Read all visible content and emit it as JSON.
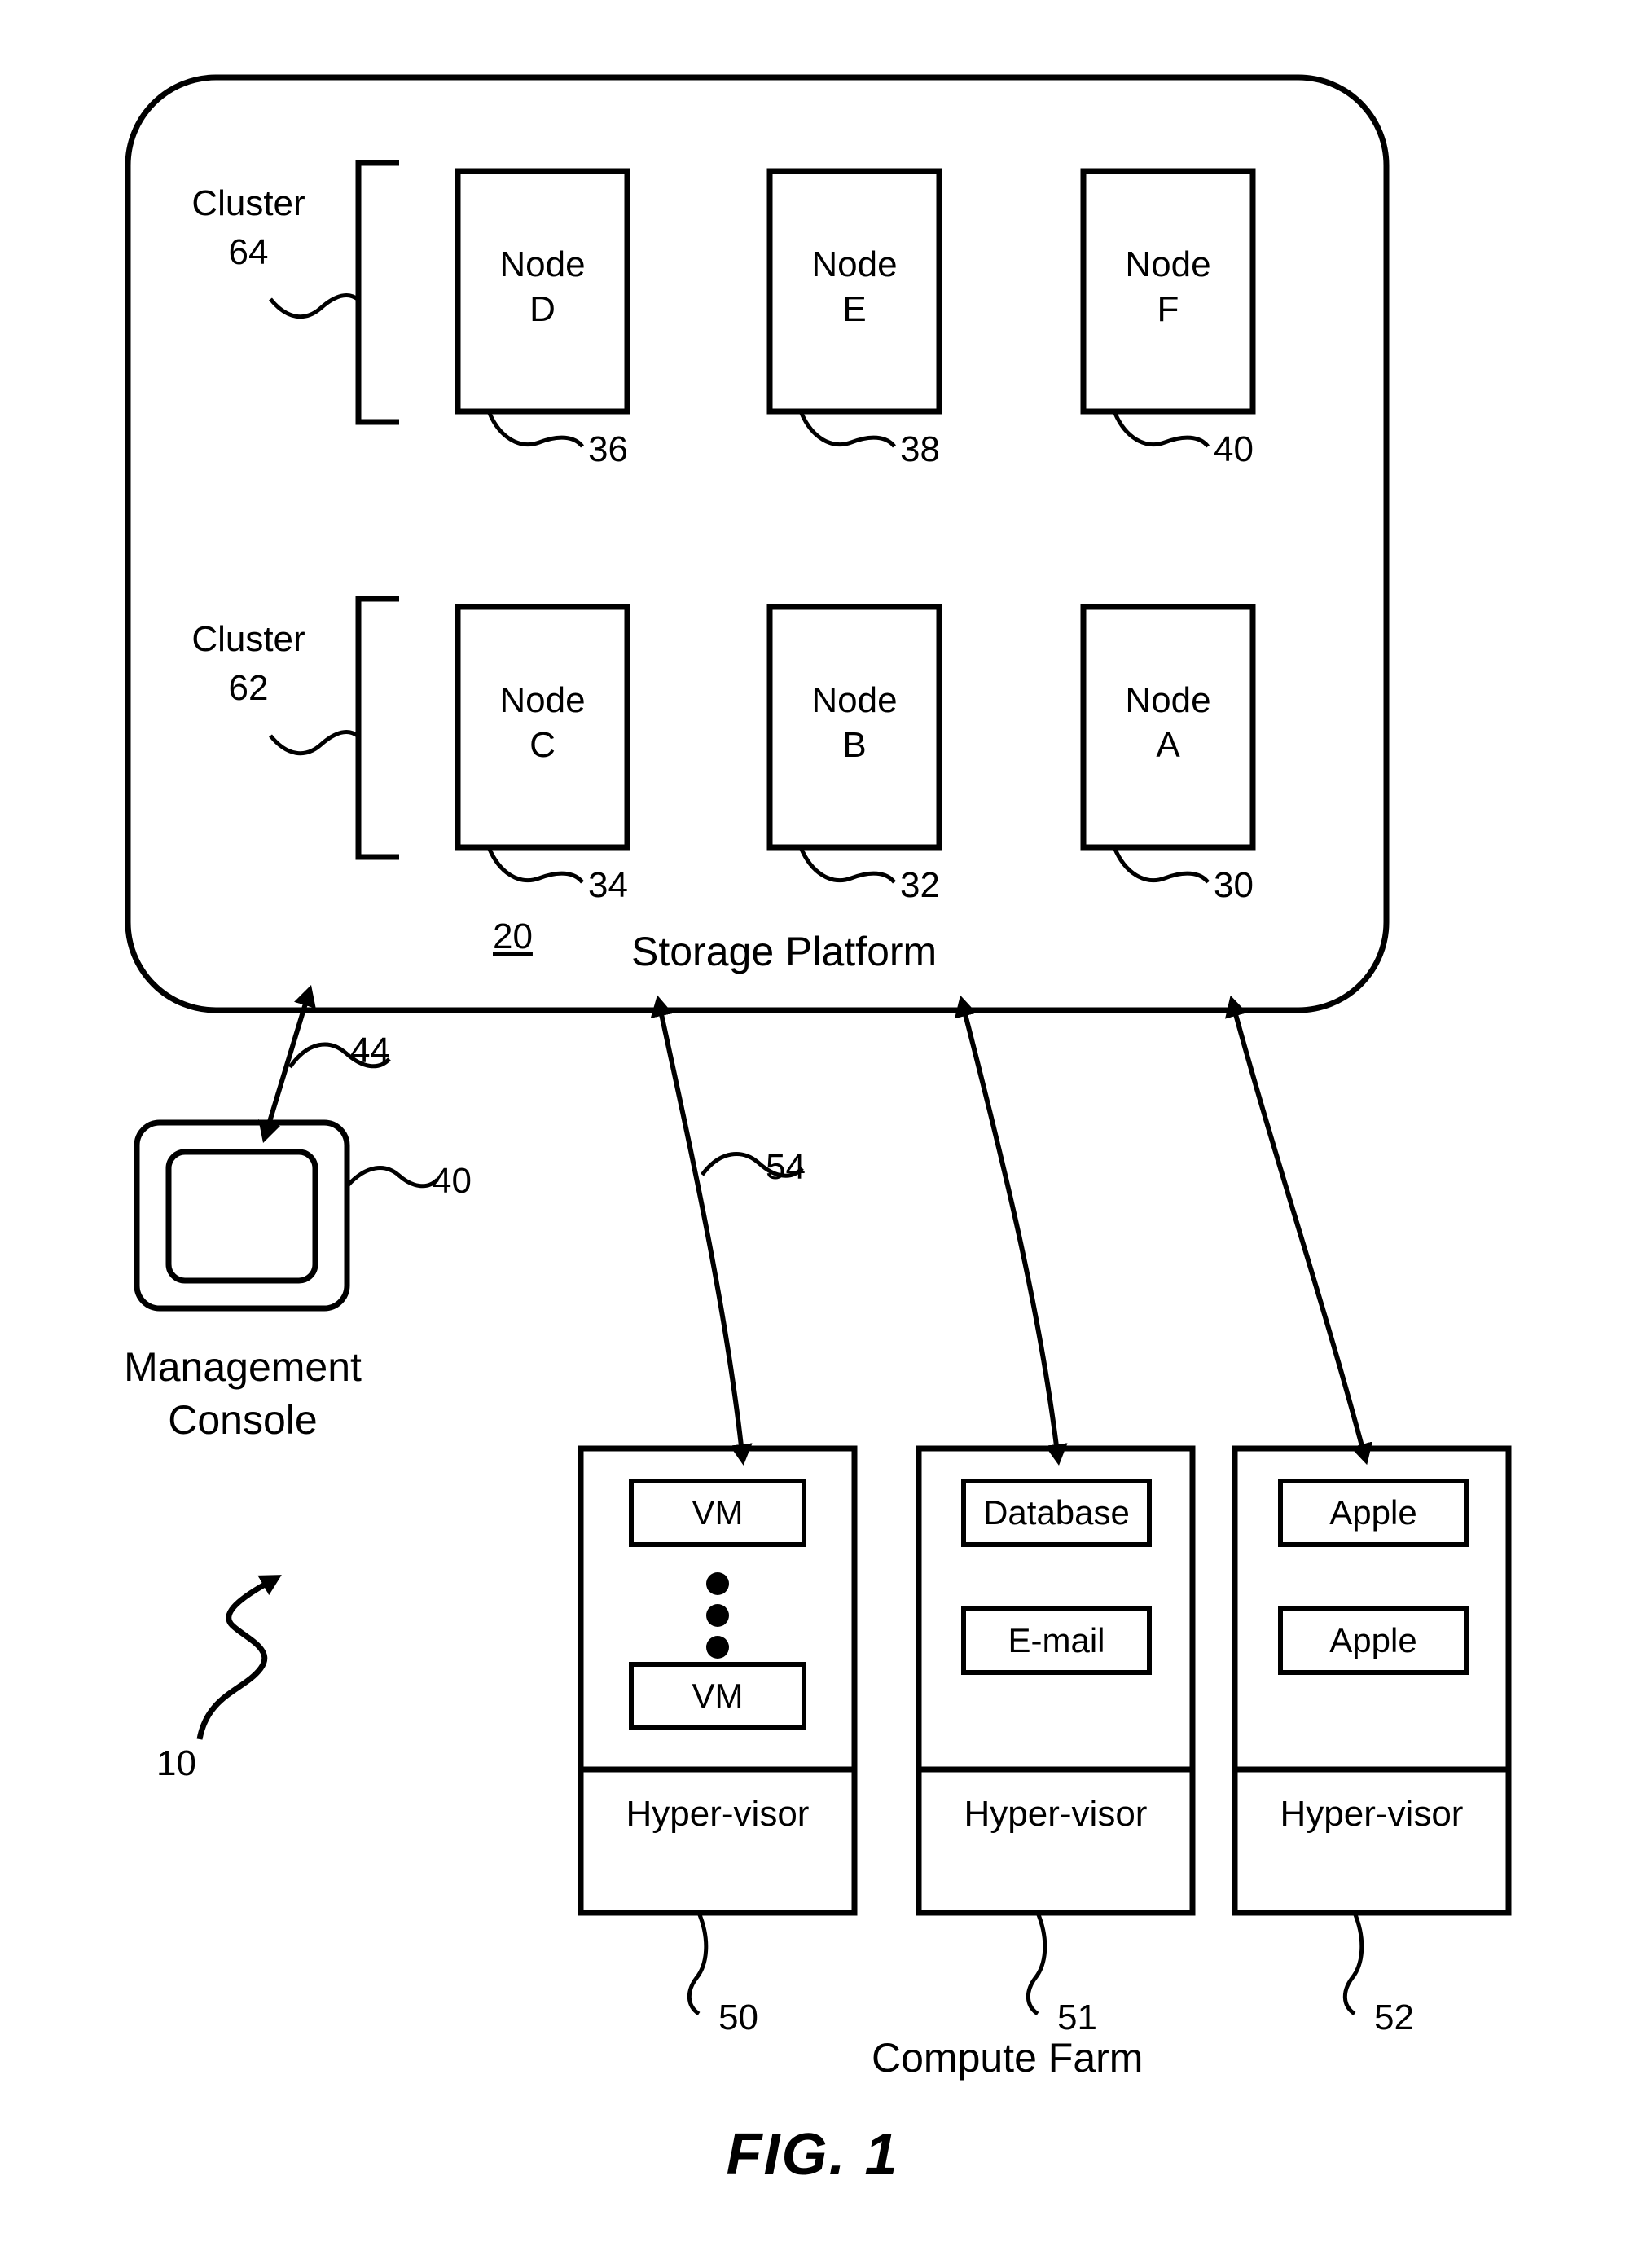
{
  "figure": {
    "caption": "FIG. 1",
    "system_ref": "10"
  },
  "storage_platform": {
    "title": "Storage Platform",
    "ref": "20",
    "clusters": [
      {
        "label": "Cluster",
        "ref": "64",
        "nodes": [
          {
            "name": "Node",
            "id": "D",
            "ref": "36"
          },
          {
            "name": "Node",
            "id": "E",
            "ref": "38"
          },
          {
            "name": "Node",
            "id": "F",
            "ref": "40"
          }
        ]
      },
      {
        "label": "Cluster",
        "ref": "62",
        "nodes": [
          {
            "name": "Node",
            "id": "C",
            "ref": "34"
          },
          {
            "name": "Node",
            "id": "B",
            "ref": "32"
          },
          {
            "name": "Node",
            "id": "A",
            "ref": "30"
          }
        ]
      }
    ]
  },
  "management_console": {
    "label_line1": "Management",
    "label_line2": "Console",
    "ref": "40",
    "link_ref": "44"
  },
  "compute_farm": {
    "title": "Compute Farm",
    "link_ref": "54",
    "hypervisor_label": "Hyper-visor",
    "servers": [
      {
        "ref": "50",
        "workloads": [
          "VM",
          "VM"
        ],
        "has_ellipsis": true,
        "hypervisor": "Hyper-visor"
      },
      {
        "ref": "51",
        "workloads": [
          "Database",
          "E-mail"
        ],
        "has_ellipsis": false,
        "hypervisor": "Hyper-visor"
      },
      {
        "ref": "52",
        "workloads": [
          "Apple",
          "Apple"
        ],
        "has_ellipsis": false,
        "hypervisor": "Hyper-visor"
      }
    ]
  },
  "colors": {
    "stroke": "#000000",
    "background": "#ffffff"
  }
}
